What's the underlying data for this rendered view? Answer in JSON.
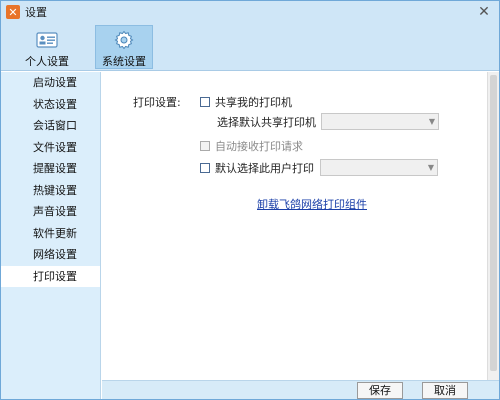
{
  "window": {
    "title": "设置",
    "logo_glyph": "✕",
    "close_glyph": "✕"
  },
  "tabs": [
    {
      "label": "个人设置",
      "icon": "id-card-icon"
    },
    {
      "label": "系统设置",
      "icon": "gear-icon"
    }
  ],
  "sidebar": {
    "items": [
      {
        "label": "启动设置"
      },
      {
        "label": "状态设置"
      },
      {
        "label": "会话窗口"
      },
      {
        "label": "文件设置"
      },
      {
        "label": "提醒设置"
      },
      {
        "label": "热键设置"
      },
      {
        "label": "声音设置"
      },
      {
        "label": "软件更新"
      },
      {
        "label": "网络设置"
      },
      {
        "label": "打印设置"
      }
    ],
    "active_index": 9
  },
  "print": {
    "section_label": "打印设置:",
    "share_printer_label": "共享我的打印机",
    "default_share_label": "选择默认共享打印机",
    "auto_receive_label": "自动接收打印请求",
    "default_user_label": "默认选择此用户打印",
    "uninstall_link": "卸载飞鸽网络打印组件"
  },
  "footer": {
    "save_label": "保存",
    "cancel_label": "取消"
  },
  "colors": {
    "accent": "#cfe6f7",
    "sidebar_bg": "#dbeefb",
    "link": "#1a3fa8"
  }
}
